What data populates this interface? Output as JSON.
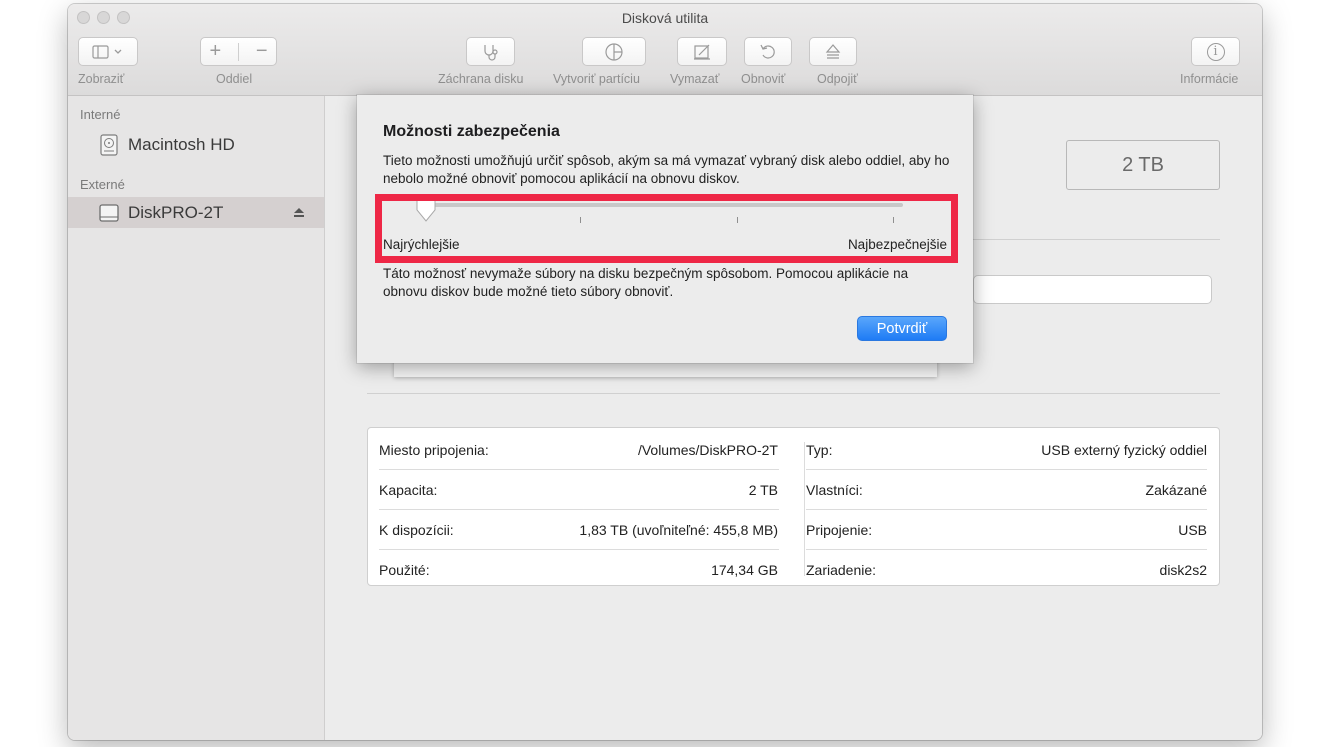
{
  "window": {
    "title": "Disková utilita"
  },
  "toolbar": {
    "view_label": "Zobraziť",
    "partition_group_label": "Oddiel",
    "add_symbol": "+",
    "remove_symbol": "−",
    "buttons": [
      {
        "label": "Záchrana disku",
        "icon": "stethoscope-icon"
      },
      {
        "label": "Vytvoriť partíciu",
        "icon": "pie-chart-icon"
      },
      {
        "label": "Vymazať",
        "icon": "erase-icon"
      },
      {
        "label": "Obnoviť",
        "icon": "restore-icon"
      },
      {
        "label": "Odpojiť",
        "icon": "eject-icon"
      }
    ],
    "info_label": "Informácie",
    "info_symbol": "i"
  },
  "sidebar": {
    "internal_header": "Interné",
    "internal_items": [
      {
        "label": "Macintosh HD"
      }
    ],
    "external_header": "Externé",
    "external_items": [
      {
        "label": "DiskPRO-2T",
        "selected": true
      }
    ]
  },
  "main": {
    "capacity_badge": "2 TB",
    "info": {
      "left": [
        {
          "label": "Miesto pripojenia:",
          "value": "/Volumes/DiskPRO-2T"
        },
        {
          "label": "Kapacita:",
          "value": "2 TB"
        },
        {
          "label": "K dispozícii:",
          "value": "1,83 TB (uvoľniteľné: 455,8 MB)"
        },
        {
          "label": "Použité:",
          "value": "174,34 GB"
        }
      ],
      "right": [
        {
          "label": "Typ:",
          "value": "USB externý fyzický oddiel"
        },
        {
          "label": "Vlastníci:",
          "value": "Zakázané"
        },
        {
          "label": "Pripojenie:",
          "value": "USB"
        },
        {
          "label": "Zariadenie:",
          "value": "disk2s2"
        }
      ]
    }
  },
  "dialog": {
    "title": "Možnosti zabezpečenia",
    "description": "Tieto možnosti umožňujú určiť spôsob, akým sa má vymazať vybraný disk alebo oddiel, aby ho nebolo možné obnoviť pomocou aplikácií na obnovu diskov.",
    "slider": {
      "min_label": "Najrýchlejšie",
      "max_label": "Najbezpečnejšie",
      "steps": 4,
      "selected_step": 0
    },
    "note": "Táto možnosť nevymaže súbory na disku bezpečným spôsobom. Pomocou aplikácie na obnovu diskov bude možné tieto súbory obnoviť.",
    "confirm_label": "Potvrdiť"
  },
  "colors": {
    "accent": "#1e7bf5",
    "highlight": "#ee2746"
  }
}
